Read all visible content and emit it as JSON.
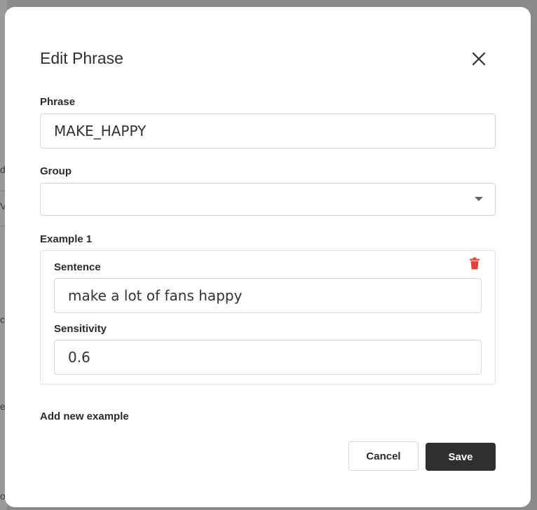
{
  "background": {
    "fragments": [
      "d",
      "V",
      "cc",
      "er",
      "o"
    ]
  },
  "dialog": {
    "title": "Edit Phrase",
    "close_icon": "close-icon",
    "phrase": {
      "label": "Phrase",
      "value": "MAKE_HAPPY"
    },
    "group": {
      "label": "Group",
      "value": "",
      "caret_icon": "caret-down-icon"
    },
    "examples": [
      {
        "label": "Example 1",
        "sentence_label": "Sentence",
        "sentence_value": "make a lot of fans happy",
        "sensitivity_label": "Sensitivity",
        "sensitivity_value": "0.6",
        "delete_icon": "trash-icon"
      }
    ],
    "add_example_label": "Add new example",
    "cancel_label": "Cancel",
    "save_label": "Save"
  },
  "colors": {
    "overlay": "#8a8a8a",
    "primary_button": "#2f2f2f",
    "delete_icon": "#e0453a",
    "border": "#d6d6d6"
  }
}
